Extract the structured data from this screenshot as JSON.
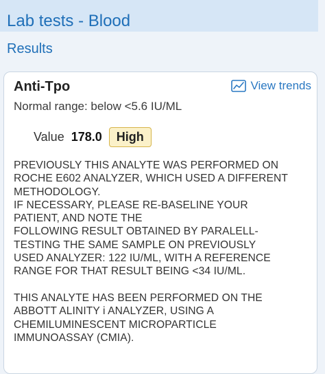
{
  "header": {
    "title": "Lab tests - Blood"
  },
  "section": {
    "title": "Results"
  },
  "card": {
    "test_name": "Anti-Tpo",
    "view_trends_label": "View trends",
    "view_trends_icon": "trend-chart-icon",
    "normal_range": "Normal range: below <5.6 IU/ML",
    "value_label": "Value",
    "value": "178.0",
    "flag": "High",
    "comment_lines": [
      "PREVIOUSLY THIS ANALYTE WAS PERFORMED ON",
      "ROCHE E602 ANALYZER, WHICH USED A DIFFERENT",
      "METHODOLOGY.",
      "IF NECESSARY, PLEASE RE-BASELINE YOUR",
      "PATIENT, AND NOTE THE",
      "FOLLOWING RESULT OBTAINED BY PARALELL-",
      "TESTING THE SAME SAMPLE ON PREVIOUSLY",
      "USED ANALYZER: 122 IU/ML, WITH A REFERENCE",
      "RANGE FOR THAT RESULT BEING <34 IU/ML.",
      "",
      "THIS ANALYTE HAS BEEN PERFORMED ON THE",
      "ABBOTT ALINITY i ANALYZER, USING A",
      "CHEMILUMINESCENT MICROPARTICLE",
      "IMMUNOASSAY (CMIA)."
    ]
  },
  "colors": {
    "accent": "#1f6fb8",
    "header_bg": "#d6e6f6",
    "flag_bg": "#fbf1c9",
    "flag_border": "#d6b44a"
  }
}
